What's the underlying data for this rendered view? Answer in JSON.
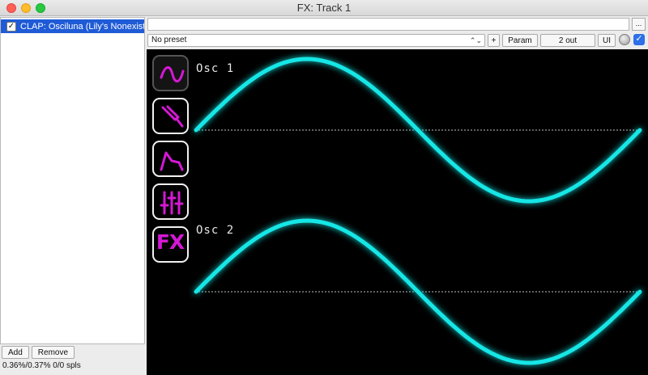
{
  "window": {
    "title": "FX: Track 1"
  },
  "fx_list": {
    "items": [
      {
        "label": "CLAP: Osciluna (Lily's Nonexistent",
        "enabled": true,
        "selected": true
      }
    ]
  },
  "buttons": {
    "add": "Add",
    "remove": "Remove"
  },
  "status": "0.36%/0.37% 0/0 spls",
  "toolbar": {
    "more": "...",
    "preset": "No preset",
    "preset_arrows": "⌃⌄",
    "plus": "+",
    "param": "Param",
    "outputs": "2 out",
    "ui": "UI",
    "bypass_checked": "✓"
  },
  "plugin": {
    "osc1_label": "Osc 1",
    "osc2_label": "Osc 2",
    "fx_tab_text": "FX",
    "wave_color": "#18e6e6",
    "icon_color": "#d418d4"
  }
}
